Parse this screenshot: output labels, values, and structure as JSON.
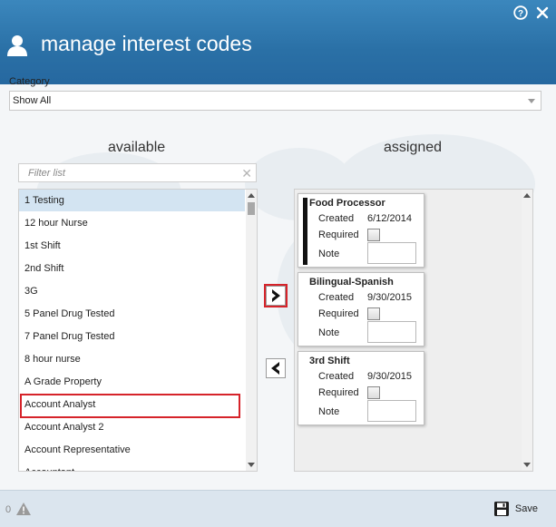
{
  "header": {
    "title": "manage interest codes",
    "help_icon": "question-circle-icon",
    "close_icon": "close-icon",
    "user_icon": "user-icon"
  },
  "category": {
    "label": "Category",
    "selected": "Show All"
  },
  "available": {
    "heading": "available",
    "filter_placeholder": "Filter list",
    "items": [
      "1 Testing",
      "12 hour Nurse",
      "1st Shift",
      "2nd Shift",
      "3G",
      "5 Panel Drug Tested",
      "7 Panel Drug Tested",
      "8 hour nurse",
      "A Grade Property",
      "Account Analyst",
      "Account Analyst 2",
      "Account Representative",
      "Accountant"
    ],
    "selected_item": "1 Testing",
    "highlighted_item": "Account Analyst"
  },
  "assigned": {
    "heading": "assigned",
    "labels": {
      "created": "Created",
      "required": "Required",
      "note": "Note"
    },
    "cards": [
      {
        "title": "Food Processor",
        "created": "6/12/2014",
        "required": false,
        "note": ""
      },
      {
        "title": "Bilingual-Spanish",
        "created": "9/30/2015",
        "required": false,
        "note": ""
      },
      {
        "title": "3rd Shift",
        "created": "9/30/2015",
        "required": false,
        "note": ""
      }
    ]
  },
  "transfer": {
    "add_icon": "chevron-right-icon",
    "remove_icon": "chevron-left-icon"
  },
  "footer": {
    "count": "0",
    "warning_icon": "warning-icon",
    "save_label": "Save",
    "save_icon": "floppy-disk-icon"
  },
  "colors": {
    "header": "#2a70a6",
    "highlight": "#d6232a",
    "selected_row": "#d3e4f2",
    "footer": "#dbe5ee"
  }
}
